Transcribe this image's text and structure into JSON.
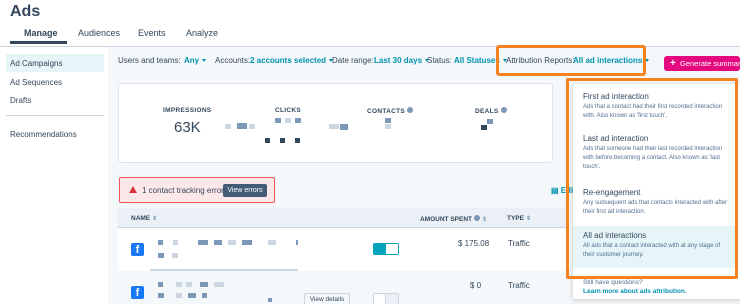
{
  "app": {
    "title": "Ads"
  },
  "tabs": [
    {
      "label": "Manage"
    },
    {
      "label": "Audiences"
    },
    {
      "label": "Events"
    },
    {
      "label": "Analyze"
    }
  ],
  "sidebar": {
    "items": [
      {
        "label": "Ad Campaigns"
      },
      {
        "label": "Ad Sequences"
      },
      {
        "label": "Drafts"
      },
      {
        "label": "Recommendations"
      }
    ]
  },
  "filters": {
    "users_label": "Users and teams:",
    "users_value": "Any",
    "accounts_label": "Accounts:",
    "accounts_value": "2 accounts selected",
    "date_label": "Date range:",
    "date_value": "Last 30 days",
    "status_label": "Status:",
    "status_value": "All Statuses",
    "attribution_label": "Attribution Reports:",
    "attribution_value": "All ad interactions",
    "generate_label": "Generate summary"
  },
  "stats": {
    "impressions_label": "IMPRESSIONS",
    "impressions_value": "63K",
    "clicks_label": "CLICKS",
    "contacts_label": "CONTACTS",
    "deals_label": "DEALS"
  },
  "error": {
    "text": "1 contact tracking error",
    "button": "View errors"
  },
  "edit_label": "Edi",
  "table": {
    "headers": {
      "name": "NAME",
      "amount": "AMOUNT SPENT",
      "type": "TYPE"
    },
    "rows": [
      {
        "amount": "$ 175.08",
        "type": "Traffic",
        "active": true
      },
      {
        "amount": "$ 0",
        "type": "Traffic",
        "active": false,
        "details": "View details"
      }
    ]
  },
  "dropdown": {
    "options": [
      {
        "title": "First ad interaction",
        "desc": "Ads that a contact had their first recorded interaction with. Also known as 'first touch'."
      },
      {
        "title": "Last ad interaction",
        "desc": "Ads that someone had their last recorded interaction with before becoming a contact. Also known as 'last touch'."
      },
      {
        "title": "Re-engagement",
        "desc": "Any subsequent ads that contacts interacted with after their first ad interaction."
      },
      {
        "title": "All ad interactions",
        "desc": "All ads that a contact interacted with at any stage of their customer journey."
      }
    ],
    "help_text": "Still have questions?",
    "help_link": "Learn more about ads attribution."
  },
  "colors": {
    "accent": "#0091ae",
    "highlight": "#f5821f",
    "brand_button": "#e4097f",
    "facebook": "#1877f2"
  }
}
